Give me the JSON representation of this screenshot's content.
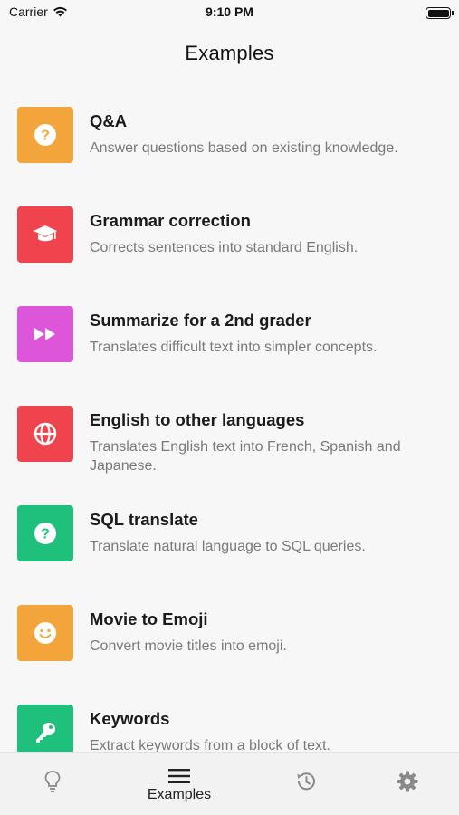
{
  "status_bar": {
    "carrier": "Carrier",
    "time": "9:10 PM"
  },
  "page": {
    "title": "Examples"
  },
  "examples": [
    {
      "title": "Q&A",
      "description": "Answer questions based on existing knowledge.",
      "icon": "question-icon",
      "color": "#f3a53b"
    },
    {
      "title": "Grammar correction",
      "description": "Corrects sentences into standard English.",
      "icon": "graduation-cap-icon",
      "color": "#ef444d"
    },
    {
      "title": "Summarize for a 2nd grader",
      "description": "Translates difficult text into simpler concepts.",
      "icon": "fast-forward-icon",
      "color": "#dd55d9"
    },
    {
      "title": "English to other languages",
      "description": "Translates English text into French, Spanish and Japanese.",
      "icon": "globe-icon",
      "color": "#ef444d"
    },
    {
      "title": "SQL translate",
      "description": "Translate natural language to SQL queries.",
      "icon": "question-icon",
      "color": "#1fc07c"
    },
    {
      "title": "Movie to Emoji",
      "description": "Convert movie titles into emoji.",
      "icon": "smiley-icon",
      "color": "#f3a53b"
    },
    {
      "title": "Keywords",
      "description": "Extract keywords from a block of text.",
      "icon": "key-icon",
      "color": "#1fc07c"
    }
  ],
  "tab_bar": {
    "items": [
      {
        "icon": "lightbulb-icon",
        "label": ""
      },
      {
        "icon": "menu-icon",
        "label": "Examples",
        "active": true
      },
      {
        "icon": "history-icon",
        "label": ""
      },
      {
        "icon": "gear-icon",
        "label": ""
      }
    ]
  }
}
